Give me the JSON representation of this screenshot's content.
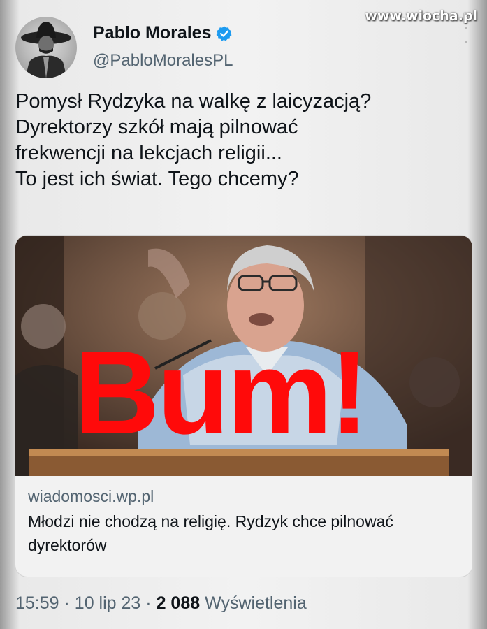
{
  "watermark": "www.wiocha.pl",
  "user": {
    "name": "Pablo Morales",
    "handle": "@PabloMoralesPL",
    "verified": true,
    "verified_icon": "verified-badge-icon",
    "verified_color": "#1d9bf0"
  },
  "tweet": {
    "lines": [
      "Pomysł Rydzyka na walkę z laicyzacją?",
      "Dyrektorzy szkół mają pilnować",
      "frekwencji na lekcjach religii...",
      "To jest ich świat. Tego chcemy?"
    ]
  },
  "card": {
    "image_overlay_text": "Bum!",
    "overlay_color": "#ff0a0a",
    "domain": "wiadomosci.wp.pl",
    "title": "Młodzi nie chodzą na religię. Rydzyk chce pilnować dyrektorów"
  },
  "meta": {
    "time": "15:59",
    "date": "10 lip 23",
    "views_count": "2 088",
    "views_label": "Wyświetlenia",
    "separator": "·"
  }
}
